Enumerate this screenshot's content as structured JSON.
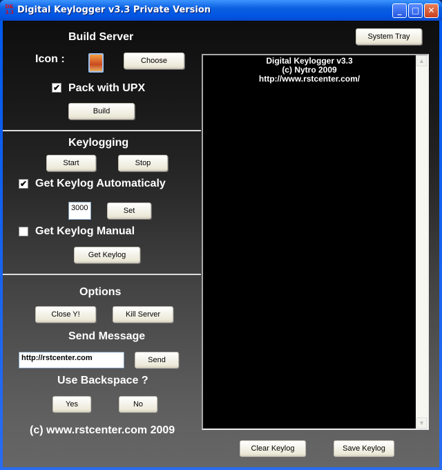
{
  "window": {
    "title": "Digital Keylogger v3.3 Private Version",
    "icon_text": "DK 3.3",
    "controls": [
      "minimize",
      "maximize",
      "close"
    ]
  },
  "build": {
    "heading": "Build Server",
    "icon_label": "Icon :",
    "choose": "Choose",
    "pack_label": "Pack with UPX",
    "pack_checked": true,
    "build": "Build"
  },
  "keylog": {
    "heading": "Keylogging",
    "start": "Start",
    "stop": "Stop",
    "auto_label": "Get Keylog Automaticaly",
    "auto_checked": true,
    "interval": "3000",
    "set": "Set",
    "manual_label": "Get Keylog Manual",
    "manual_checked": false,
    "get": "Get Keylog"
  },
  "options": {
    "heading": "Options",
    "close": "Close Y!",
    "kill": "Kill Server",
    "send_heading": "Send Message",
    "message": "http://rstcenter.com",
    "send": "Send",
    "backspace_heading": "Use Backspace ?",
    "yes": "Yes",
    "no": "No",
    "copyright": "(c) www.rstcenter.com 2009"
  },
  "right": {
    "system_tray": "System Tray",
    "log_text": "Digital Keylogger v3.3\n(c) Nytro 2009\nhttp://www.rstcenter.com/",
    "clear": "Clear Keylog",
    "save": "Save Keylog"
  }
}
